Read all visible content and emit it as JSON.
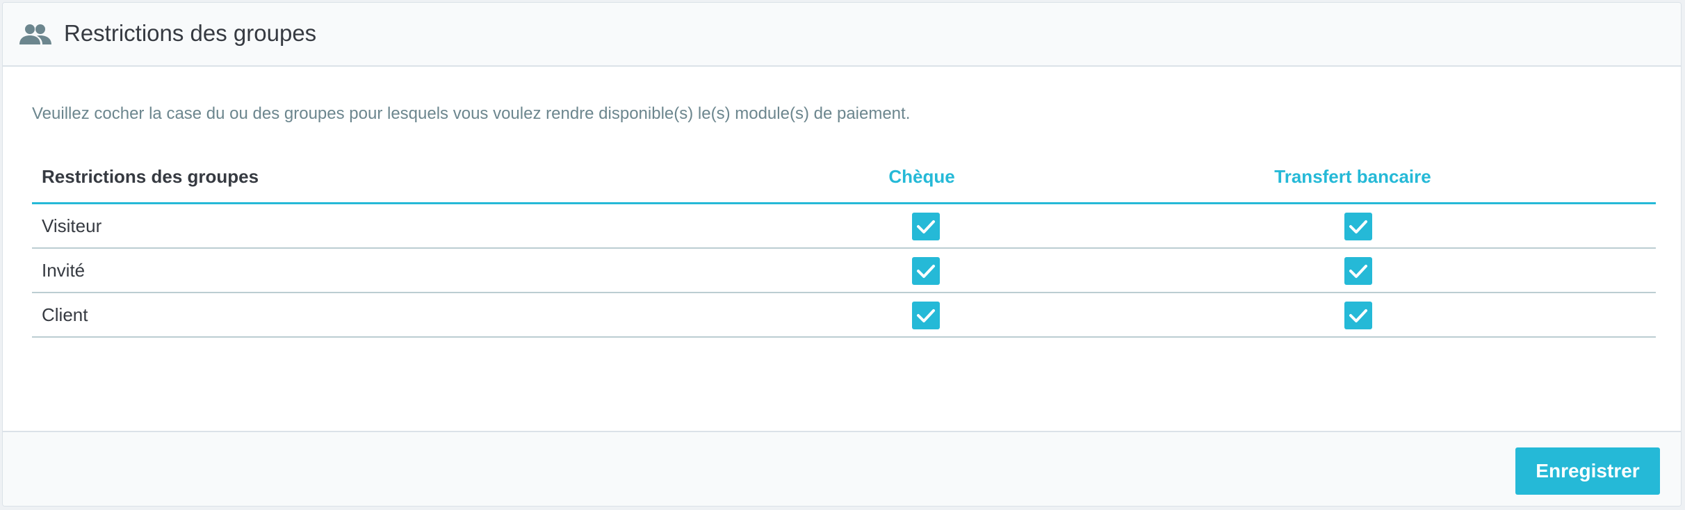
{
  "header": {
    "icon": "users-icon",
    "title": "Restrictions des groupes"
  },
  "description": "Veuillez cocher la case du ou des groupes pour lesquels vous voulez rendre disponible(s) le(s) module(s) de paiement.",
  "table": {
    "columns": [
      "Restrictions des groupes",
      "Chèque",
      "Transfert bancaire"
    ],
    "rows": [
      {
        "label": "Visiteur",
        "cheque": true,
        "transfert": true
      },
      {
        "label": "Invité",
        "cheque": true,
        "transfert": true
      },
      {
        "label": "Client",
        "cheque": true,
        "transfert": true
      }
    ]
  },
  "footer": {
    "save_label": "Enregistrer"
  },
  "colors": {
    "accent": "#25b9d7",
    "text": "#363a41",
    "muted": "#6c868e"
  }
}
